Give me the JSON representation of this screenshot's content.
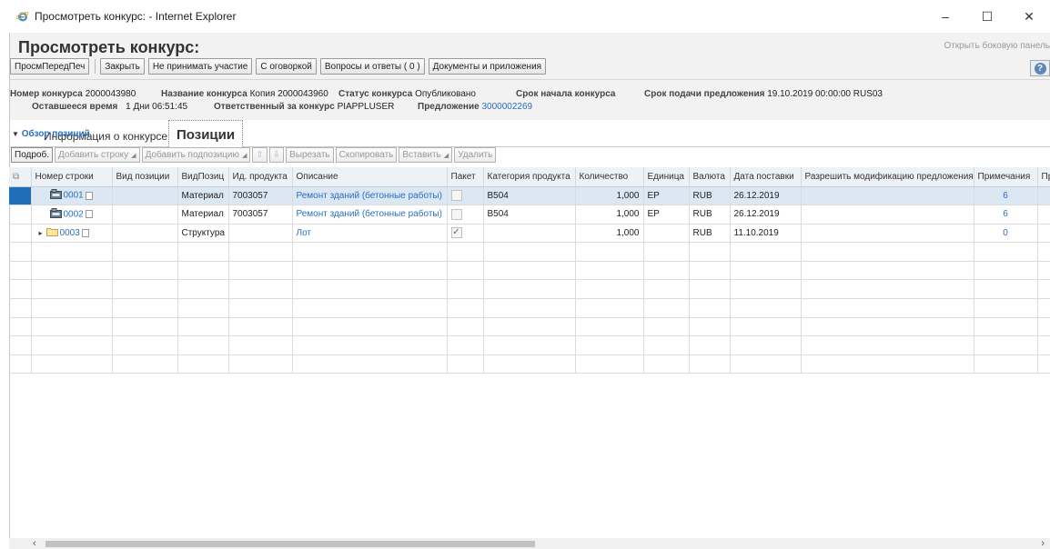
{
  "window": {
    "title": "Просмотреть конкурс: - Internet Explorer",
    "controls": [
      "–",
      "☐",
      "✕"
    ]
  },
  "header": {
    "title": "Просмотреть конкурс:",
    "side_panel_link": "Открыть боковую панель"
  },
  "toolbar": {
    "buttons": [
      "ПросмПередПеч",
      "Закрыть",
      "Не принимать участие",
      "С оговоркой",
      "Вопросы и ответы ( 0 )",
      "Документы и приложения"
    ],
    "help_icon": "?"
  },
  "info": {
    "number_label": "Номер конкурса",
    "number_value": "2000043980",
    "name_label": "Название конкурса",
    "name_value": "Копия 2000043960",
    "status_label": "Статус конкурса",
    "status_value": "Опубликовано",
    "start_label": "Срок начала конкурса",
    "deadline_label": "Срок подачи предложения",
    "deadline_value": "19.10.2019 00:00:00 RUS03",
    "remaining_label": "Оставшееся время",
    "remaining_value": "1 Дни 06:51:45",
    "responsible_label": "Ответственный за конкурс",
    "responsible_value": "PIAPPLUSER",
    "offer_label": "Предложение",
    "offer_value": "3000002269"
  },
  "tabs": [
    "Информация о конкурсе",
    "Позиции"
  ],
  "section_title": "Обзор позиций",
  "table_toolbar": {
    "details": "Подроб.",
    "add_row": "Добавить строку",
    "add_subposition": "Добавить подпозицию",
    "up_icon": "⇧",
    "down_icon": "⇩",
    "cut": "Вырезать",
    "copy": "Скопировать",
    "paste": "Вставить",
    "delete": "Удалить"
  },
  "columns": [
    "Номер строки",
    "Вид позиции",
    "ВидПозиц",
    "Ид. продукта",
    "Описание",
    "Пакет",
    "Категория продукта",
    "Количество",
    "Единица",
    "Валюта",
    "Дата поставки",
    "Разрешить модификацию предложения",
    "Примечания",
    "Пр"
  ],
  "rows": [
    {
      "line": "0001",
      "item_kind": "",
      "pos_type": "Материал",
      "product_id": "7003057",
      "description": "Ремонт зданий (бетонные работы)",
      "package": false,
      "category": "B504",
      "quantity": "1,000",
      "unit": "EP",
      "currency": "RUB",
      "delivery": "26.12.2019",
      "allow_mod": "",
      "notes": "6",
      "selected": true,
      "icon": "material"
    },
    {
      "line": "0002",
      "item_kind": "",
      "pos_type": "Материал",
      "product_id": "7003057",
      "description": "Ремонт зданий (бетонные работы)",
      "package": false,
      "category": "B504",
      "quantity": "1,000",
      "unit": "EP",
      "currency": "RUB",
      "delivery": "26.12.2019",
      "allow_mod": "",
      "notes": "6",
      "selected": false,
      "icon": "material"
    },
    {
      "line": "0003",
      "item_kind": "",
      "pos_type": "Структура",
      "product_id": "",
      "description": "Лот",
      "package": true,
      "category": "",
      "quantity": "1,000",
      "unit": "",
      "currency": "RUB",
      "delivery": "11.10.2019",
      "allow_mod": "",
      "notes": "0",
      "selected": false,
      "icon": "folder"
    }
  ],
  "empty_rows": 7,
  "scrollbar": {
    "left_arrow": "‹",
    "right_arrow": "›"
  }
}
